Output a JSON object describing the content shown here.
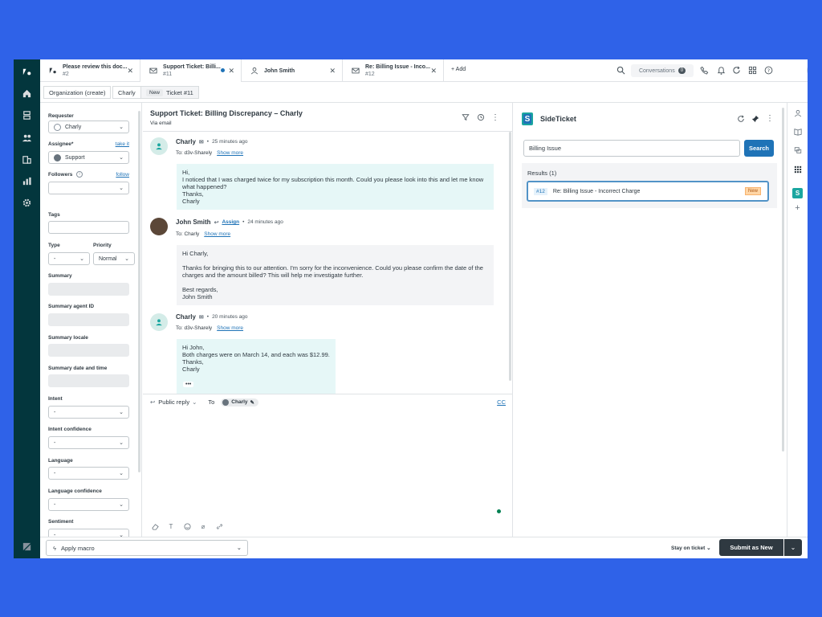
{
  "tabs": [
    {
      "title": "Please review this doc...",
      "subtitle": "#2"
    },
    {
      "title": "Support Ticket: Billi...",
      "subtitle": "#11"
    },
    {
      "title": "John Smith",
      "subtitle": ""
    },
    {
      "title": "Re: Billing Issue - Inco...",
      "subtitle": "#12"
    }
  ],
  "add_tab_label": "+ Add",
  "conversations": {
    "label": "Conversations",
    "count": "0"
  },
  "breadcrumbs": {
    "org": "Organization (create)",
    "user": "Charly",
    "new_badge": "New",
    "ticket": "Ticket #11"
  },
  "props": {
    "requester_label": "Requester",
    "requester_value": "Charly",
    "assignee_label": "Assignee*",
    "assignee_link": "take it",
    "assignee_value": "Support",
    "followers_label": "Followers",
    "followers_link": "follow",
    "tags_label": "Tags",
    "type_label": "Type",
    "type_value": "-",
    "priority_label": "Priority",
    "priority_value": "Normal",
    "summary_label": "Summary",
    "summary_agent_label": "Summary agent ID",
    "summary_locale_label": "Summary locale",
    "summary_date_label": "Summary date and time",
    "intent_label": "Intent",
    "intent_value": "-",
    "intent_conf_label": "Intent confidence",
    "intent_conf_value": "-",
    "language_label": "Language",
    "language_value": "-",
    "language_conf_label": "Language confidence",
    "language_conf_value": "-",
    "sentiment_label": "Sentiment",
    "sentiment_value": "-"
  },
  "ticket": {
    "title": "Support Ticket: Billing Discrepancy – Charly",
    "via": "Via email"
  },
  "messages": [
    {
      "name": "Charly",
      "time": "25 minutes ago",
      "to": "To: d3v-Sharely",
      "show_more": "Show more",
      "body": "Hi,\nI noticed that I was charged twice for my subscription this month. Could you please look into this and let me know what happened?\nThanks,\nCharly"
    },
    {
      "name": "John Smith",
      "assign": "Assign",
      "time": "24 minutes ago",
      "to": "To: Charly",
      "show_more": "Show more",
      "body": "Hi Charly,\n\nThanks for bringing this to our attention. I'm sorry for the inconvenience. Could you please confirm the date of the charges and the amount billed? This will help me investigate further.\n\nBest regards,\nJohn Smith"
    },
    {
      "name": "Charly",
      "time": "20 minutes ago",
      "to": "To: d3v-Sharely",
      "show_more": "Show more",
      "body": "Hi John,\nBoth charges were on March 14, and each was $12.99.\nThanks,\nCharly"
    }
  ],
  "reply": {
    "mode": "Public reply",
    "to_label": "To",
    "to_chip": "Charly",
    "cc": "CC"
  },
  "sideticket": {
    "title": "SideTicket",
    "search_value": "Billing Issue",
    "search_button": "Search",
    "results_label": "Results (1)",
    "result": {
      "id": "#12",
      "title": "Re: Billing Issue - Incorrect Charge",
      "status": "New"
    }
  },
  "bottom": {
    "macro": "Apply macro",
    "stay": "Stay on ticket",
    "submit": "Submit as New"
  },
  "colors": {
    "brand_bg": "#2f62e8",
    "nav": "#03363d",
    "accent": "#1f73b7",
    "submit": "#2f3941"
  }
}
